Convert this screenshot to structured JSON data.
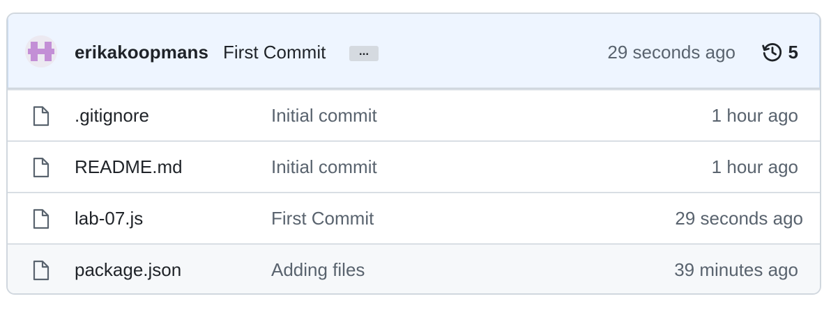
{
  "latest_commit": {
    "author": "erikakoopmans",
    "message": "First Commit",
    "more_label": "...",
    "time": "29 seconds ago",
    "history_count": "5",
    "avatar_icon": "identicon-avatar",
    "history_icon": "history-clock-icon"
  },
  "files": [
    {
      "name": ".gitignore",
      "commit": "Initial commit",
      "time": "1 hour ago",
      "icon": "file-icon"
    },
    {
      "name": "README.md",
      "commit": "Initial commit",
      "time": "1 hour ago",
      "icon": "file-icon"
    },
    {
      "name": "lab-07.js",
      "commit": "First Commit",
      "time": "29 seconds ago",
      "icon": "file-icon"
    },
    {
      "name": "package.json",
      "commit": "Adding files",
      "time": "39 minutes ago",
      "icon": "file-icon"
    }
  ],
  "colors": {
    "header_bg": "#eef5ff",
    "border": "#d0d7de",
    "muted_text": "#59636e",
    "avatar_pink": "#c38fd6",
    "hover_row_bg": "#f6f8fa"
  }
}
